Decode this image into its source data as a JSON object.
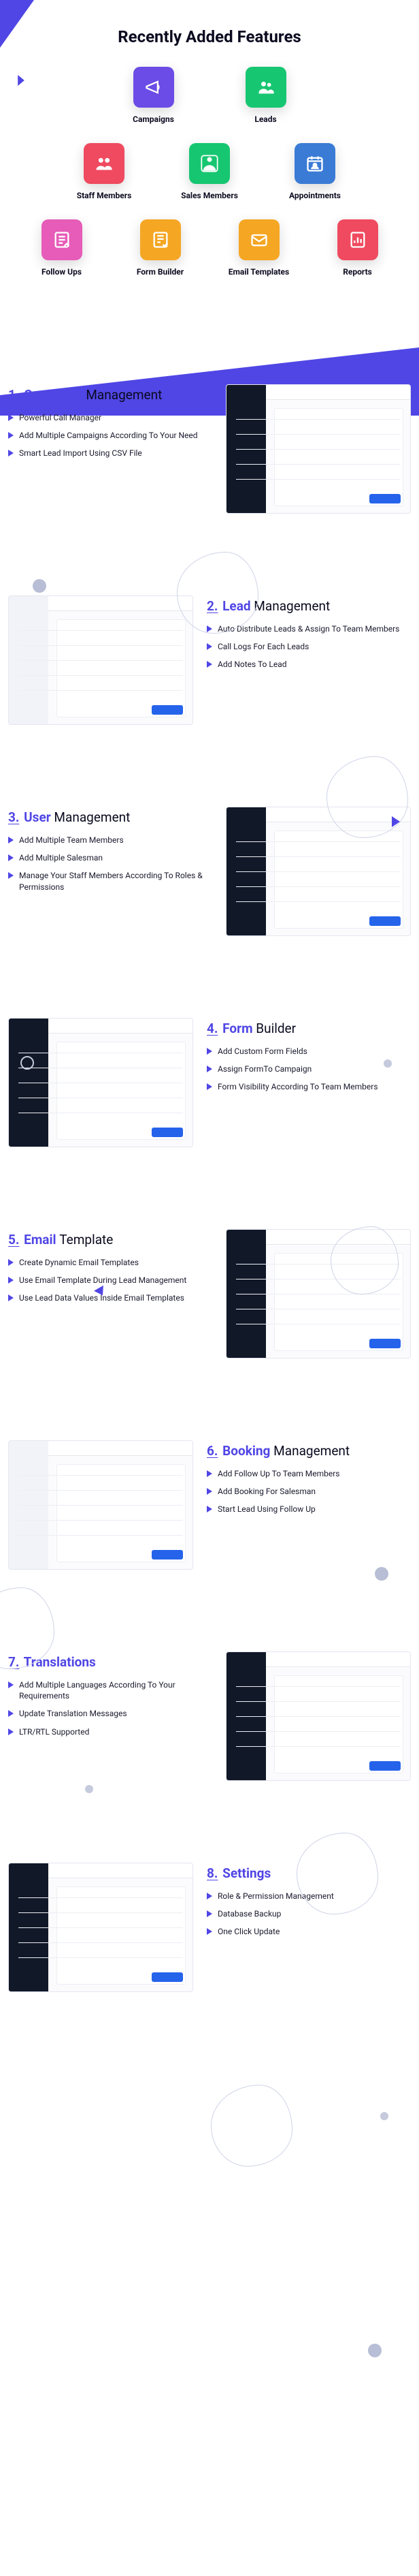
{
  "hero": {
    "title": "Recently Added Features",
    "features": [
      {
        "label": "Campaigns",
        "icon": "bullhorn-icon",
        "color": "fi-purple"
      },
      {
        "label": "Leads",
        "icon": "people-icon",
        "color": "fi-green"
      },
      {
        "label": "Staff Members",
        "icon": "staff-icon",
        "color": "fi-red"
      },
      {
        "label": "Sales Members",
        "icon": "sales-icon",
        "color": "fi-green"
      },
      {
        "label": "Appointments",
        "icon": "calendar-user-icon",
        "color": "fi-blue"
      },
      {
        "label": "Follow Ups",
        "icon": "followup-icon",
        "color": "fi-pink"
      },
      {
        "label": "Form Builder",
        "icon": "form-icon",
        "color": "fi-orange"
      },
      {
        "label": "Email Templates",
        "icon": "mail-icon",
        "color": "fi-orange"
      },
      {
        "label": "Reports",
        "icon": "chart-icon",
        "color": "fi-red"
      }
    ]
  },
  "sections": [
    {
      "num": "1.",
      "accent": "Campaign",
      "rest": "Management",
      "layout": "left",
      "bullets": [
        "Powerful Call Manager",
        "Add Multiple Campaigns According To Your Need",
        "Smart Lead Import Using CSV File"
      ]
    },
    {
      "num": "2.",
      "accent": "Lead",
      "rest": "Management",
      "layout": "right",
      "bullets": [
        "Auto Distribute Leads & Assign To Team Members",
        "Call Logs For Each Leads",
        "Add Notes To Lead"
      ]
    },
    {
      "num": "3.",
      "accent": "User",
      "rest": "Management",
      "layout": "left",
      "bullets": [
        "Add Multiple Team Members",
        "Add Multiple Salesman",
        "Manage Your Staff Members According To Roles & Permissions"
      ]
    },
    {
      "num": "4.",
      "accent": "Form",
      "rest": "Builder",
      "layout": "right",
      "bullets": [
        "Add Custom Form Fields",
        "Assign FormTo Campaign",
        "Form Visibility According To Team Members"
      ]
    },
    {
      "num": "5.",
      "accent": " Email",
      "rest": "Template",
      "layout": "left",
      "bullets": [
        "Create Dynamic Email Templates",
        "Use Email Template During Lead Management",
        "Use Lead Data Values Inside Email Templates"
      ]
    },
    {
      "num": "6.",
      "accent": "Booking",
      "rest": "Management",
      "layout": "right",
      "bullets": [
        "Add Follow Up To Team Members",
        "Add Booking For Salesman",
        "Start Lead Using Follow Up"
      ]
    },
    {
      "num": "7.",
      "accent": "Translations",
      "rest": "",
      "layout": "left",
      "bullets": [
        "Add Multiple Languages According To Your Requirements",
        "Update Translation Messages",
        "LTR/RTL Supported"
      ]
    },
    {
      "num": "8.",
      "accent": "Settings",
      "rest": "",
      "layout": "right",
      "bullets": [
        "Role & Permission Management",
        "Database Backup",
        "One Click Update"
      ]
    }
  ]
}
